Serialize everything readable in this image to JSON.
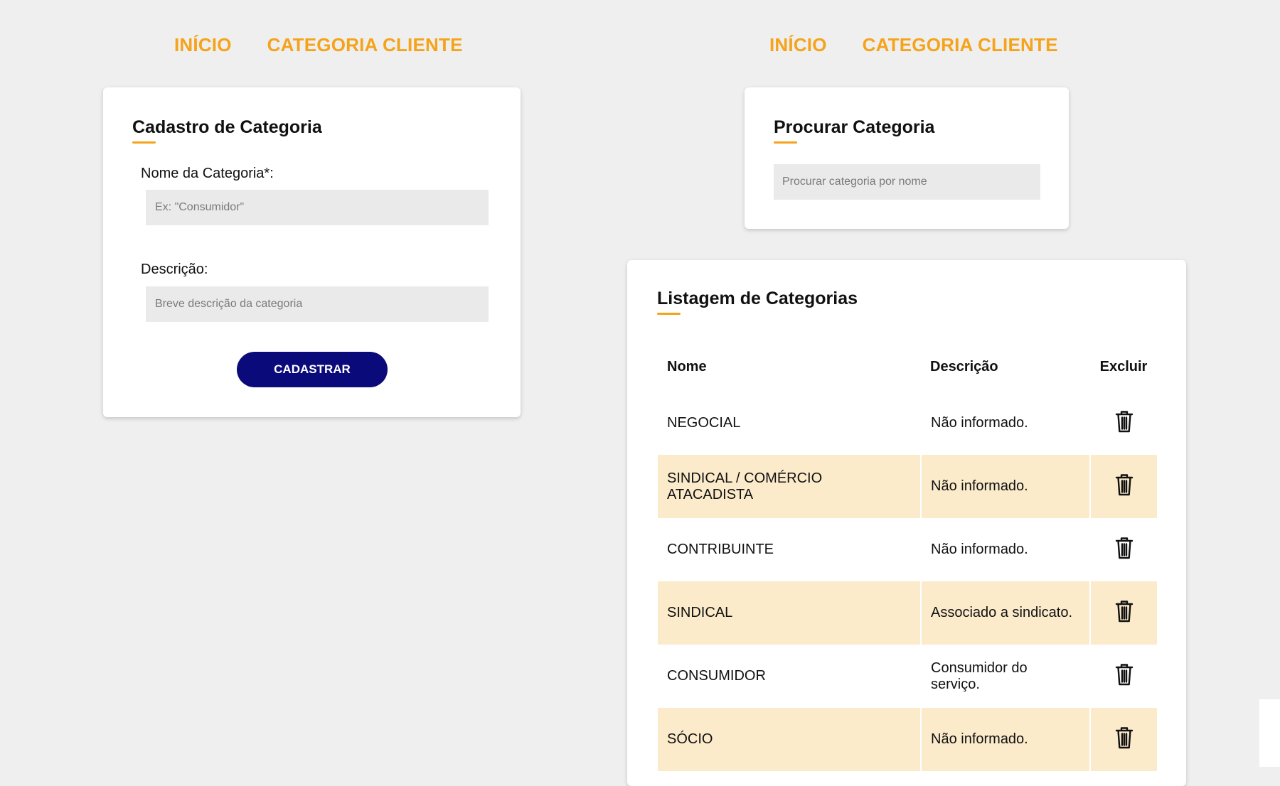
{
  "nav": {
    "home": "INÍCIO",
    "category": "CATEGORIA CLIENTE"
  },
  "form": {
    "title": "Cadastro de Categoria",
    "name_label": "Nome da Categoria*:",
    "name_placeholder": "Ex: \"Consumidor\"",
    "desc_label": "Descrição:",
    "desc_placeholder": "Breve descrição da categoria",
    "submit_label": "CADASTRAR"
  },
  "search": {
    "title": "Procurar Categoria",
    "placeholder": "Procurar categoria por nome"
  },
  "list": {
    "title": "Listagem de Categorias",
    "headers": {
      "name": "Nome",
      "description": "Descrição",
      "delete": "Excluir"
    },
    "rows": [
      {
        "name": "NEGOCIAL",
        "description": "Não informado."
      },
      {
        "name": "SINDICAL / COMÉRCIO ATACADISTA",
        "description": "Não informado."
      },
      {
        "name": "CONTRIBUINTE",
        "description": "Não informado."
      },
      {
        "name": "SINDICAL",
        "description": "Associado a sindicato."
      },
      {
        "name": "CONSUMIDOR",
        "description": "Consumidor do serviço."
      },
      {
        "name": "SÓCIO",
        "description": "Não informado."
      }
    ]
  },
  "icons": {
    "delete": "trash-icon"
  },
  "colors": {
    "accent": "#f5a31a",
    "button": "#0a0a7a",
    "row_highlight": "#fcebcb",
    "background": "#efefef"
  }
}
